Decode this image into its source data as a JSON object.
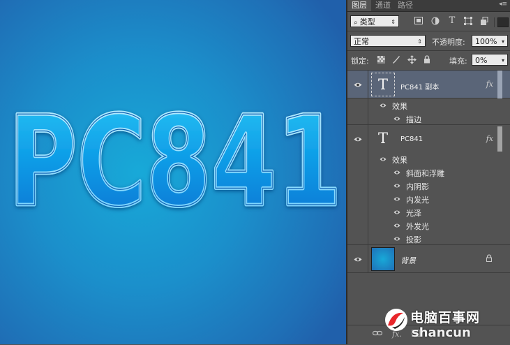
{
  "canvas": {
    "text": "PC841"
  },
  "panel": {
    "tabs": [
      "图层",
      "通道",
      "路径"
    ],
    "filter": {
      "kind_label": "类型"
    },
    "blend": {
      "mode": "正常",
      "opacity_label": "不透明度:",
      "opacity_value": "100%"
    },
    "lock": {
      "label": "锁定:",
      "fill_label": "填充:",
      "fill_value": "0%"
    },
    "layers": [
      {
        "name": "PC841 副本",
        "effects_label": "效果",
        "effects": [
          "描边"
        ],
        "fx": "fx"
      },
      {
        "name": "PC841",
        "effects_label": "效果",
        "effects": [
          "斜面和浮雕",
          "内阴影",
          "内发光",
          "光泽",
          "外发光",
          "投影"
        ],
        "fx": "fx"
      },
      {
        "name": "背景"
      }
    ],
    "bottom": {
      "fx": "fx."
    }
  },
  "watermark": {
    "title": "电脑百事网",
    "subtitle": "shancun"
  },
  "colors": {
    "panel_bg": "#535353",
    "selected_layer": "#5a6578",
    "canvas_bg": "#1b8fcb",
    "text_fill": "#14b5f0"
  },
  "icons": [
    "eye-icon",
    "text-layer-icon",
    "lock-icon",
    "fx-icon",
    "link-icon",
    "filter-icon"
  ]
}
